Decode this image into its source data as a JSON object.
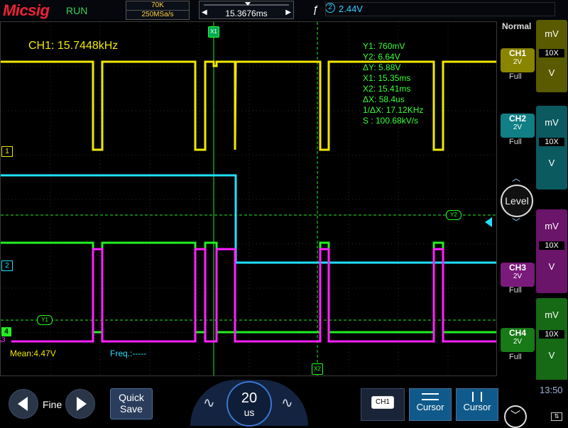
{
  "header": {
    "brand": "Micsig",
    "run_state": "RUN",
    "memory_depth": "70K",
    "sample_rate": "250MSa/s",
    "time_offset": "15.3676ms",
    "trigger_level": "2.44V",
    "trigger_channel": "2"
  },
  "measurements": {
    "frequency_top": "CH1: 15.7448kHz",
    "mean": "Mean:4.47V",
    "freq_bottom": "Freq.:-----"
  },
  "cursor_readout": {
    "y1": "Y1:  760mV",
    "y2": "Y2:  6.64V",
    "dy": "ΔY:  5.88V",
    "x1": "X1:  15.35ms",
    "x2": "X2:  15.41ms",
    "dx": "ΔX:  58.4us",
    "inv_dx": "1/ΔX:  17.12KHz",
    "slope": "S :  100.68kV/s"
  },
  "cursor_labels": {
    "x1": "X1",
    "x2": "X2",
    "y1": "Y1",
    "y2": "Y2"
  },
  "channel_markers": {
    "ch1": "1",
    "ch2": "2",
    "ch3": "3",
    "ch4": "4"
  },
  "right_panel": {
    "mode": "Normal",
    "level_label": "Level",
    "channels": [
      {
        "name": "CH1",
        "scale": "2V",
        "bw": "Full",
        "unit_top": "mV",
        "probe": "10X",
        "unit_bottom": "V",
        "color": "#c7c000"
      },
      {
        "name": "CH2",
        "scale": "2V",
        "bw": "Full",
        "unit_top": "mV",
        "probe": "10X",
        "unit_bottom": "V",
        "color": "#00c0c8"
      },
      {
        "name": "CH3",
        "scale": "2V",
        "bw": "Full",
        "unit_top": "mV",
        "probe": "10X",
        "unit_bottom": "V",
        "color": "#c800c8"
      },
      {
        "name": "CH4",
        "scale": "2V",
        "bw": "Full",
        "unit_top": "mV",
        "probe": "10X",
        "unit_bottom": "V",
        "color": "#20c020"
      }
    ]
  },
  "bottom": {
    "fine_label": "Fine",
    "quick_save_line1": "Quick",
    "quick_save_line2": "Save",
    "timebase_value": "20",
    "timebase_unit": "us",
    "ch_select": "CH1",
    "cursor_h_label": "Cursor",
    "cursor_v_label": "Cursor",
    "clock": "13:50"
  },
  "colors": {
    "ch1": "#f0e800",
    "ch2": "#20e0ff",
    "ch3": "#ff20ff",
    "ch4": "#22ee22"
  }
}
